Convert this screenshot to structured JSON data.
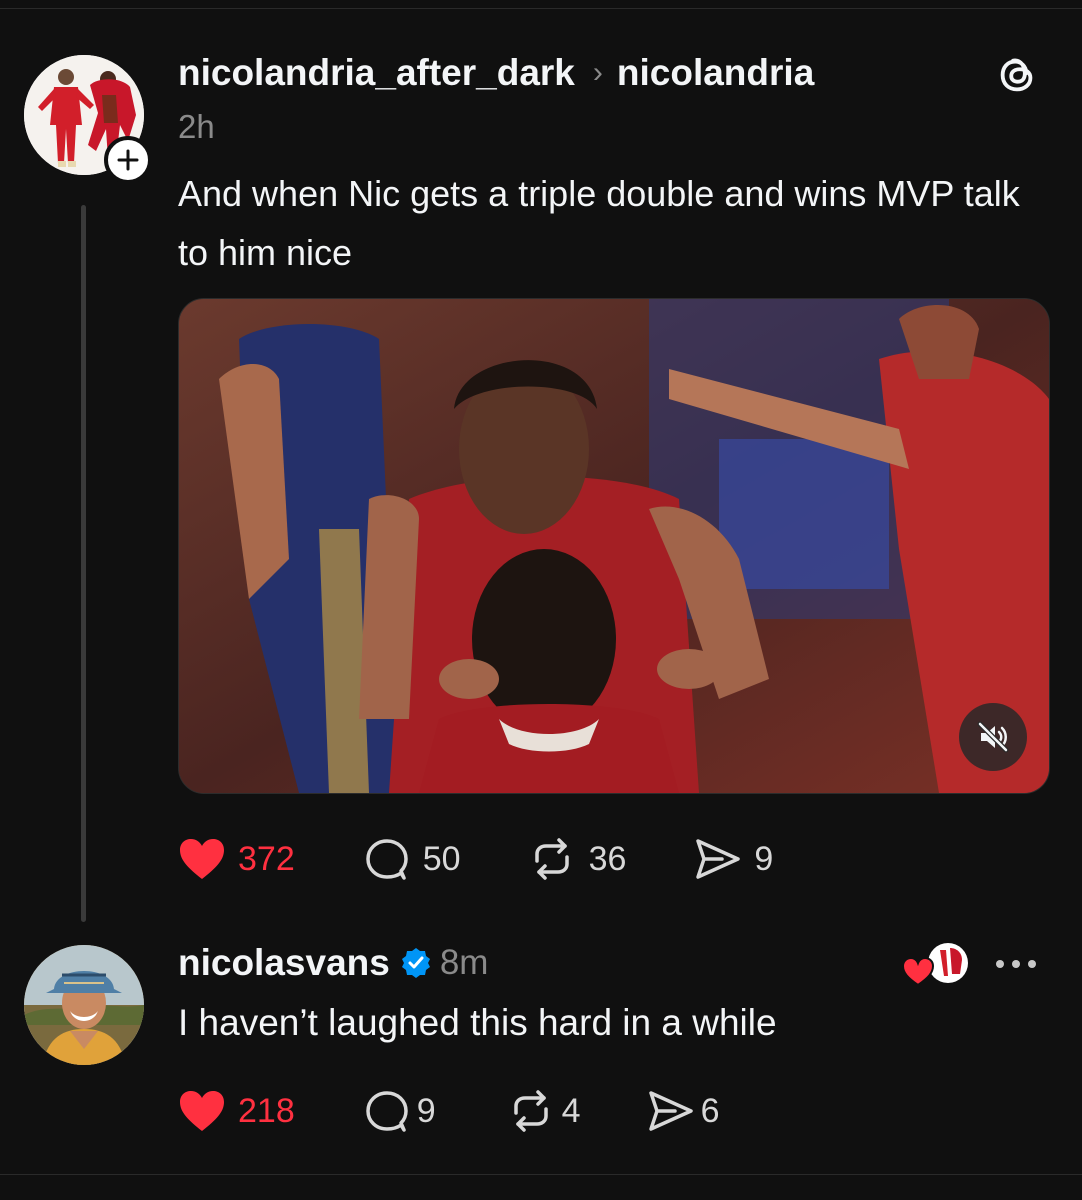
{
  "post": {
    "author": "nicolandria_after_dark",
    "reply_to": "nicolandria",
    "separator": "›",
    "time": "2h",
    "text": "And when Nic gets a triple double and wins MVP talk to him nice",
    "stats": {
      "likes": "372",
      "replies": "50",
      "reposts": "36",
      "shares": "9"
    },
    "liked": true
  },
  "reply": {
    "author": "nicolasvans",
    "verified": true,
    "time": "8m",
    "text": "I haven’t laughed this hard in a while",
    "stats": {
      "likes": "218",
      "replies": "9",
      "reposts": "4",
      "shares": "6"
    },
    "liked": true
  },
  "icons": {
    "follow": "plus-icon",
    "app": "threads-logo-icon",
    "mute": "speaker-muted-icon",
    "like": "heart-icon",
    "reply": "comment-bubble-icon",
    "repost": "repost-icon",
    "share": "send-icon",
    "more": "ellipsis-icon"
  },
  "colors": {
    "background": "#101010",
    "like_red": "#ff3040",
    "verified_blue": "#0095f6",
    "muted_text": "#8a8a8a"
  }
}
